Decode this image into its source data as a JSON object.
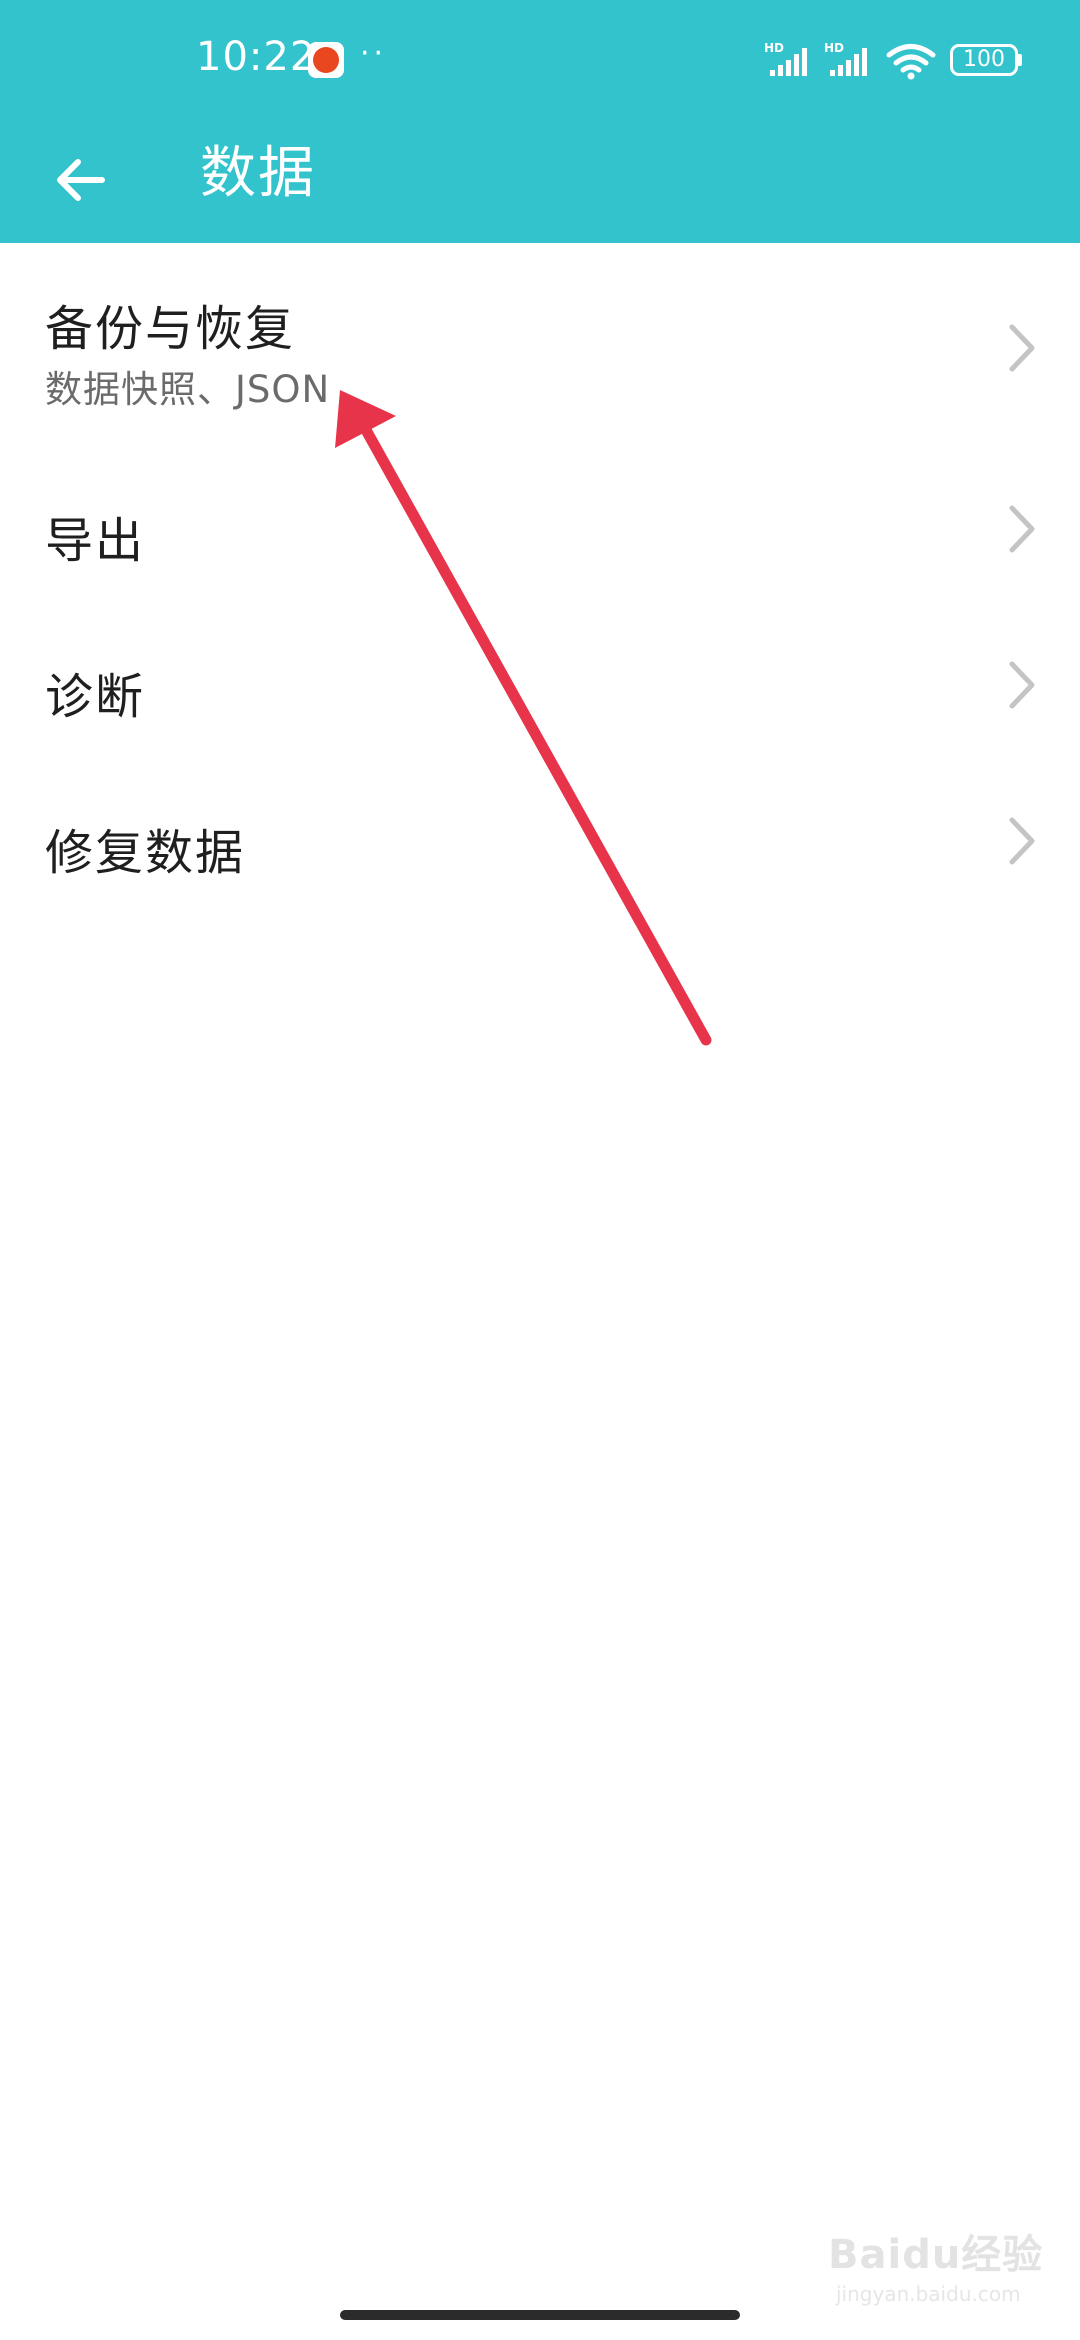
{
  "status_bar": {
    "time": "10:22",
    "more_indicator": "··",
    "signal_label_1": "HD",
    "signal_label_2": "HD",
    "battery": "100",
    "icons": [
      "app-notification-icon",
      "signal-icon",
      "signal-icon",
      "wifi-icon",
      "battery-icon"
    ]
  },
  "app_bar": {
    "title": "数据",
    "back_icon": "arrow-left-icon"
  },
  "list": {
    "items": [
      {
        "title": "备份与恢复",
        "subtitle": "数据快照、JSON"
      },
      {
        "title": "导出"
      },
      {
        "title": "诊断"
      },
      {
        "title": "修复数据"
      }
    ],
    "chevron_icon": "chevron-right-icon"
  },
  "watermark": {
    "text": "Baidu经验",
    "sub": "jingyan.baidu.com"
  },
  "colors": {
    "app_bar": "#33C3CC",
    "annotation_arrow": "#E8344A",
    "primary_text": "#1f1f1f",
    "secondary_text": "#6b6b6b",
    "chevron": "#c4c4c4"
  }
}
